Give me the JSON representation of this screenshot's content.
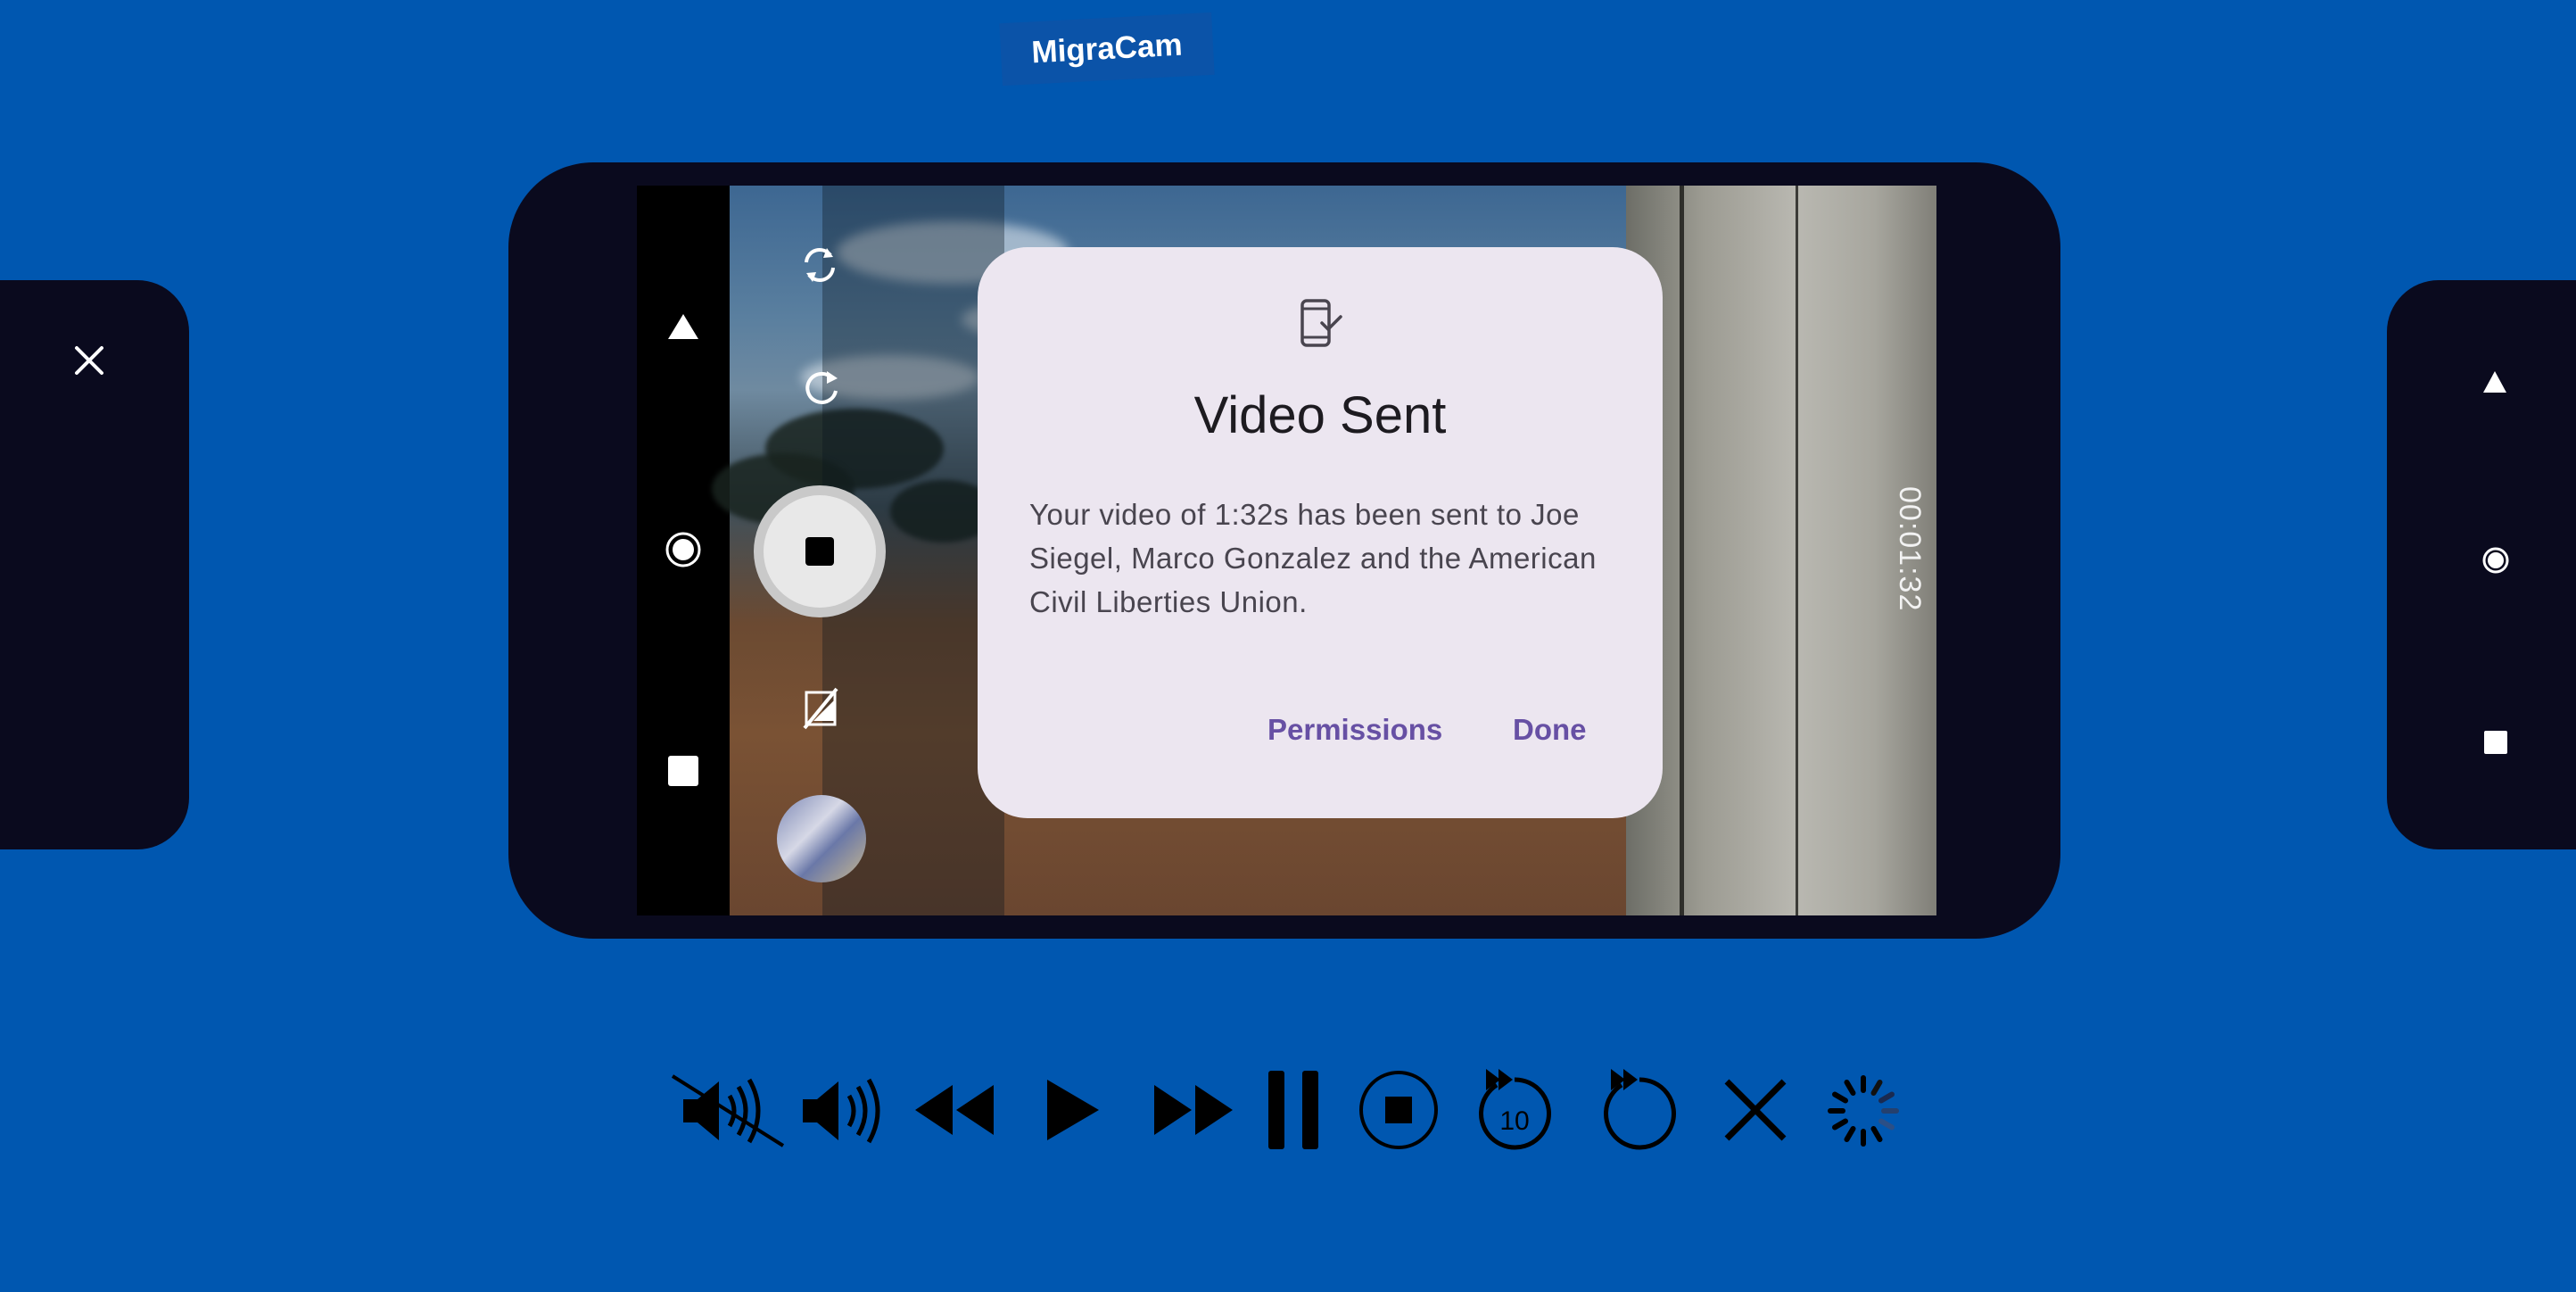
{
  "app": {
    "logo": "MigraCam",
    "timer": "00:01:32"
  },
  "dialog": {
    "title": "Video Sent",
    "body": "Your video of 1:32s has been sent to Joe Siegel, Marco Gonzalez and the American Civil Liberties Union.",
    "permissions_label": "Permissions",
    "done_label": "Done"
  },
  "icons": {
    "left_panel": [
      "close-icon"
    ],
    "right_panel": [
      "nav-back-icon",
      "nav-home-icon",
      "nav-recents-icon"
    ],
    "phone_navbar": [
      "nav-back-icon",
      "nav-home-icon",
      "nav-recents-icon"
    ],
    "camera_controls": [
      "switch-camera-icon",
      "rotate-icon",
      "stop-record-button",
      "flash-off-icon",
      "gallery-thumbnail"
    ],
    "media_bar": [
      "volume-muted-icon",
      "volume-icon",
      "rewind-icon",
      "play-icon",
      "fast-forward-icon",
      "pause-icon",
      "stop-circle-icon",
      "replay-10-icon",
      "replay-icon",
      "close-icon",
      "loading-spinner-icon"
    ]
  },
  "colors": {
    "background": "#0057B0",
    "device": "#0A0A1E",
    "dialog": "#ECE6F0",
    "dialog_button": "#6750A4",
    "logo_bg": "#0B53A8"
  }
}
